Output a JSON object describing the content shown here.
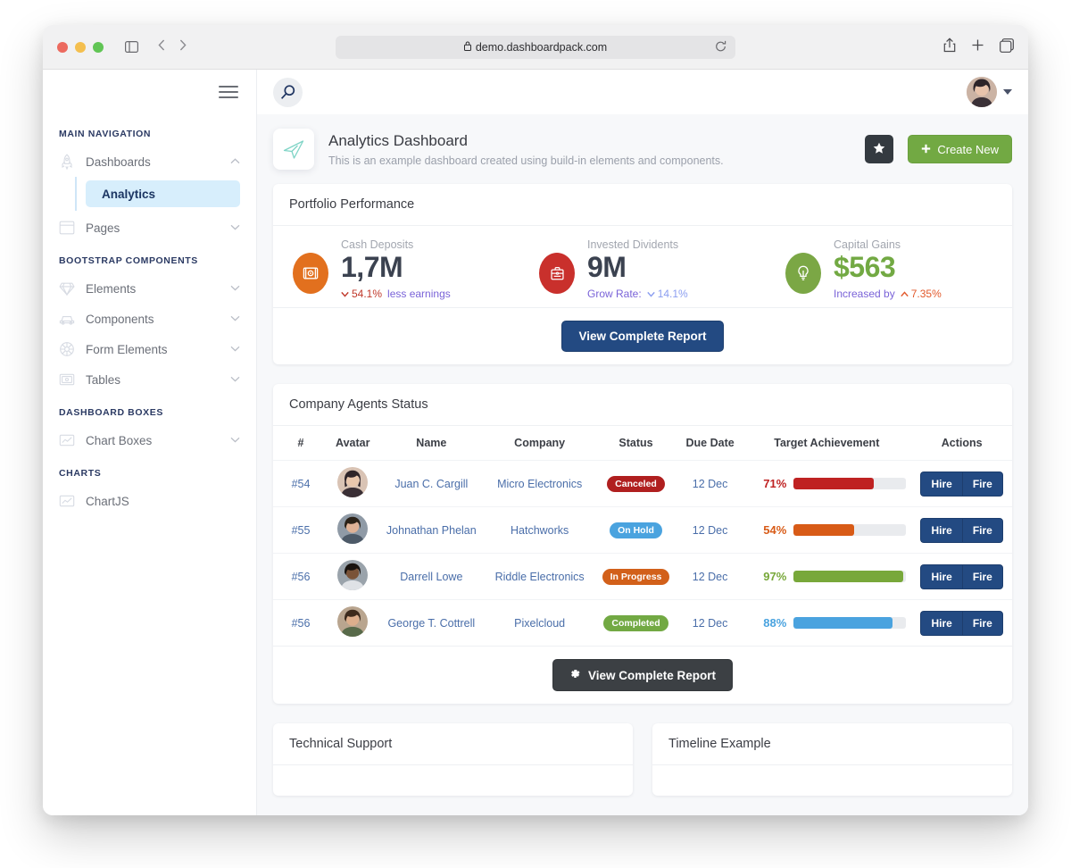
{
  "browser": {
    "url": "demo.dashboardpack.com",
    "lock_icon": "lock-icon",
    "shield_icon": "shield-icon",
    "reload_icon": "reload-icon",
    "back_icon": "chevron-left-icon",
    "forward_icon": "chevron-right-icon",
    "sidebar_icon": "sidebar-toggle-icon",
    "share_icon": "share-icon",
    "new_tab_icon": "plus-icon",
    "tabs_icon": "tab-overview-icon"
  },
  "sidebar": {
    "sections": [
      {
        "label": "MAIN NAVIGATION",
        "items": [
          {
            "label": "Dashboards",
            "icon": "rocket-icon",
            "chevron": "chevron-up-icon",
            "expanded": true,
            "children": [
              {
                "label": "Analytics",
                "active": true
              }
            ]
          },
          {
            "label": "Pages",
            "icon": "window-icon",
            "chevron": "chevron-down-icon",
            "expanded": false,
            "children": []
          }
        ]
      },
      {
        "label": "BOOTSTRAP COMPONENTS",
        "items": [
          {
            "label": "Elements",
            "icon": "diamond-icon",
            "chevron": "chevron-down-icon",
            "expanded": false,
            "children": []
          },
          {
            "label": "Components",
            "icon": "car-icon",
            "chevron": "chevron-down-icon",
            "expanded": false,
            "children": []
          },
          {
            "label": "Form Elements",
            "icon": "helm-icon",
            "chevron": "chevron-down-icon",
            "expanded": false,
            "children": []
          },
          {
            "label": "Tables",
            "icon": "table-icon",
            "chevron": "chevron-down-icon",
            "expanded": false,
            "children": []
          }
        ]
      },
      {
        "label": "DASHBOARD BOXES",
        "items": [
          {
            "label": "Chart Boxes",
            "icon": "chart-icon",
            "chevron": "chevron-down-icon",
            "expanded": false,
            "children": []
          }
        ]
      },
      {
        "label": "CHARTS",
        "items": [
          {
            "label": "ChartJS",
            "icon": "chart-icon",
            "chevron": "",
            "expanded": false,
            "children": []
          }
        ]
      }
    ]
  },
  "topbar": {
    "menu_icon": "hamburger-menu-icon",
    "search_icon": "search-icon",
    "avatar": "user-avatar",
    "caret": "chevron-down-icon"
  },
  "page_header": {
    "icon": "airplane-icon",
    "title": "Analytics Dashboard",
    "subtitle": "This is an example dashboard created using build-in elements and components.",
    "star_button": {
      "icon": "star-icon",
      "label": ""
    },
    "create_button": {
      "icon": "plus-icon",
      "label": "Create New",
      "color": "#72a943"
    }
  },
  "portfolio": {
    "title": "Portfolio Performance",
    "metrics": [
      {
        "label": "Cash Deposits",
        "value": "1,7M",
        "icon": "money-icon",
        "icon_color": "#e2701e",
        "value_color": "#3b4250",
        "sub": [
          {
            "text": "54.1%",
            "color": "#c0392b",
            "arrow": "down"
          },
          {
            "text": "less earnings",
            "color": "#7a63d8",
            "arrow": ""
          }
        ]
      },
      {
        "label": "Invested Dividents",
        "value": "9M",
        "icon": "briefcase-icon",
        "icon_color": "#c9302c",
        "value_color": "#3b4250",
        "sub": [
          {
            "text": "Grow Rate:",
            "color": "#7a63d8",
            "arrow": ""
          },
          {
            "text": "14.1%",
            "color": "#8b9ef0",
            "arrow": "down"
          }
        ]
      },
      {
        "label": "Capital Gains",
        "value": "$563",
        "icon": "lightbulb-icon",
        "icon_color": "#7ba745",
        "value_color": "#72a943",
        "sub": [
          {
            "text": "Increased by",
            "color": "#7a63d8",
            "arrow": ""
          },
          {
            "text": "7.35%",
            "color": "#e2592b",
            "arrow": "up"
          }
        ]
      }
    ],
    "footer_button": {
      "label": "View Complete Report",
      "color": "#234a82"
    }
  },
  "agents": {
    "title": "Company Agents Status",
    "columns": [
      "#",
      "Avatar",
      "Name",
      "Company",
      "Status",
      "Due Date",
      "Target Achievement",
      "Actions"
    ],
    "rows": [
      {
        "id": "#54",
        "name": "Juan C. Cargill",
        "company": "Micro Electronics",
        "status": {
          "label": "Canceled",
          "color": "#b01f1f"
        },
        "due_date": "12 Dec",
        "percent": 71,
        "percent_label": "71%",
        "bar_color": "#bf2222",
        "actions": [
          "Hire",
          "Fire"
        ],
        "avatar": "avatar-female-1"
      },
      {
        "id": "#55",
        "name": "Johnathan Phelan",
        "company": "Hatchworks",
        "status": {
          "label": "On Hold",
          "color": "#4aa3df"
        },
        "due_date": "12 Dec",
        "percent": 54,
        "percent_label": "54%",
        "bar_color": "#d85b17",
        "actions": [
          "Hire",
          "Fire"
        ],
        "avatar": "avatar-male-1"
      },
      {
        "id": "#56",
        "name": "Darrell Lowe",
        "company": "Riddle Electronics",
        "status": {
          "label": "In Progress",
          "color": "#d2601a"
        },
        "due_date": "12 Dec",
        "percent": 97,
        "percent_label": "97%",
        "bar_color": "#78a83a",
        "actions": [
          "Hire",
          "Fire"
        ],
        "avatar": "avatar-male-2"
      },
      {
        "id": "#56",
        "name": "George T. Cottrell",
        "company": "Pixelcloud",
        "status": {
          "label": "Completed",
          "color": "#72a943"
        },
        "due_date": "12 Dec",
        "percent": 88,
        "percent_label": "88%",
        "bar_color": "#4aa3df",
        "actions": [
          "Hire",
          "Fire"
        ],
        "avatar": "avatar-male-3"
      }
    ],
    "footer_button": {
      "label": "View Complete Report",
      "icon": "gear-icon",
      "color": "#3c4044"
    }
  },
  "bottom_cards": [
    {
      "title": "Technical Support"
    },
    {
      "title": "Timeline Example"
    }
  ]
}
